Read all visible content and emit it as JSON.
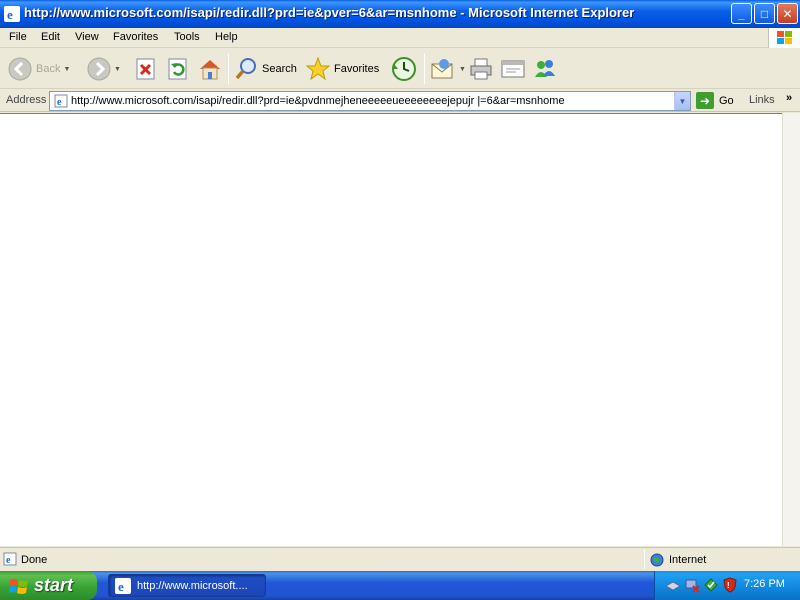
{
  "window": {
    "title": "http://www.microsoft.com/isapi/redir.dll?prd=ie&pver=6&ar=msnhome - Microsoft Internet Explorer",
    "controls": {
      "minimize": "_",
      "maximize": "□",
      "close": "✕"
    }
  },
  "menu": {
    "items": [
      "File",
      "Edit",
      "View",
      "Favorites",
      "Tools",
      "Help"
    ]
  },
  "toolbar": {
    "back_label": "Back",
    "search_label": "Search",
    "favorites_label": "Favorites",
    "icons": [
      "back-icon",
      "forward-icon",
      "stop-icon",
      "refresh-icon",
      "home-icon",
      "search-icon",
      "favorites-star-icon",
      "history-icon",
      "mail-icon",
      "print-icon",
      "edit-icon",
      "messenger-icon"
    ]
  },
  "address_bar": {
    "label": "Address",
    "url": "http://www.microsoft.com/isapi/redir.dll?prd=ie&pvdnmejheneeeeeueeeeeeeejepujr |=6&ar=msnhome",
    "go_label": "Go",
    "links_label": "Links"
  },
  "status_bar": {
    "status": "Done",
    "zone": "Internet"
  },
  "taskbar": {
    "start_label": "start",
    "task_label": "http://www.microsoft....",
    "clock": "7:26 PM"
  },
  "colors": {
    "titlebar_blue": "#0054e3",
    "taskbar_blue": "#2157d7",
    "start_green": "#38a336",
    "chrome_beige": "#ece9d8"
  }
}
